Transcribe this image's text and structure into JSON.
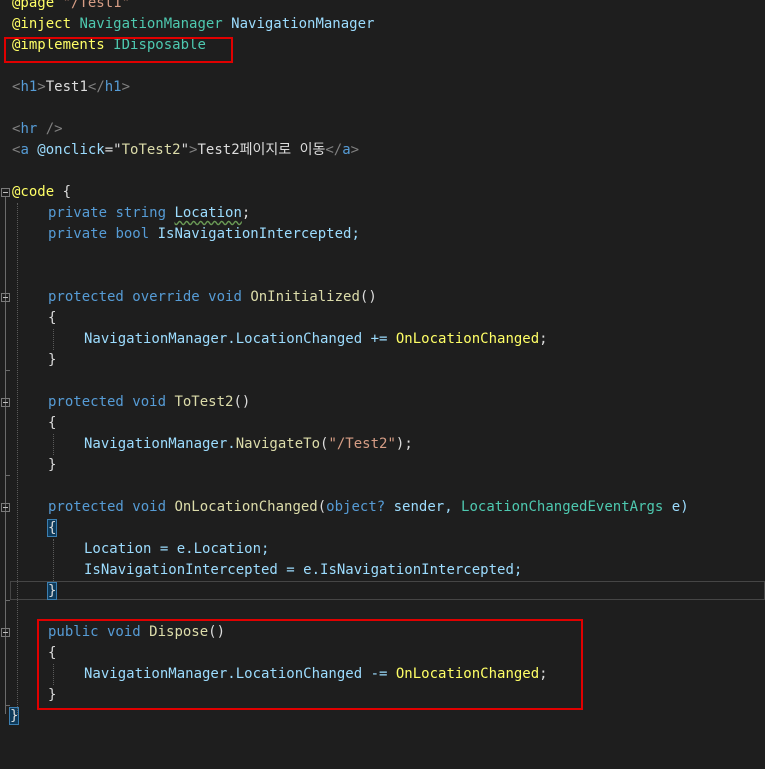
{
  "lines": {
    "l1": {
      "a": "@page ",
      "b": "\"/Test1\""
    },
    "l2": {
      "a": "@inject ",
      "b": "NavigationManager",
      "c": " NavigationManager"
    },
    "l3": {
      "a": "@implements ",
      "b": "IDisposable"
    },
    "l5": {
      "a": "<",
      "b": "h1",
      "c": ">",
      "d": "Test1",
      "e": "</",
      "f": "h1",
      "g": ">"
    },
    "l7": {
      "a": "<",
      "b": "hr",
      "c": " />"
    },
    "l8": {
      "a": "<",
      "b": "a",
      "c": " @onclick",
      "d": "=\"",
      "e": "ToTest2",
      "f": "\"",
      "g": ">",
      "h": "Test2페이지로 이동",
      "i": "</",
      "j": "a",
      "k": ">"
    },
    "l10": {
      "a": "@code",
      "b": " {"
    },
    "l11": {
      "a": "private",
      "b": " string ",
      "c": "Location",
      "d": ";"
    },
    "l12": {
      "a": "private",
      "b": " bool ",
      "c": "IsNavigationIntercepted;"
    },
    "l15": {
      "a": "protected",
      "b": " override ",
      "c": "void ",
      "d": "OnInitialized",
      "e": "()"
    },
    "l16": {
      "a": "{"
    },
    "l17": {
      "a": "NavigationManager.LocationChanged += ",
      "b": "OnLocationChanged",
      "c": ";"
    },
    "l18": {
      "a": "}"
    },
    "l20": {
      "a": "protected",
      "b": " void ",
      "c": "ToTest2",
      "d": "()"
    },
    "l21": {
      "a": "{"
    },
    "l22": {
      "a": "NavigationManager.",
      "b": "NavigateTo",
      "c": "(",
      "d": "\"/Test2\"",
      "e": ");"
    },
    "l23": {
      "a": "}"
    },
    "l25": {
      "a": "protected",
      "b": " void ",
      "c": "OnLocationChanged",
      "d": "(",
      "e": "object?",
      "f": " sender, ",
      "g": "LocationChangedEventArgs",
      "h": " e)"
    },
    "l26": {
      "a": "{"
    },
    "l27": {
      "a": "Location = ",
      "b": "e",
      "c": ".Location;"
    },
    "l28": {
      "a": "IsNavigationIntercepted = ",
      "b": "e",
      "c": ".IsNavigationIntercepted;"
    },
    "l29": {
      "a": "}"
    },
    "l31": {
      "a": "public",
      "b": " void ",
      "c": "Dispose",
      "d": "()"
    },
    "l32": {
      "a": "{"
    },
    "l33": {
      "a": "NavigationManager.LocationChanged -= ",
      "b": "OnLocationChanged",
      "c": ";"
    },
    "l34": {
      "a": "}"
    },
    "l35": {
      "a": "}"
    }
  },
  "colors": {
    "background": "#1e1e1e",
    "keyword": "#569cd6",
    "razor_directive": "#ffff66",
    "type": "#4ec9b0",
    "method": "#dcdcaa",
    "string": "#d69d85",
    "highlight_box": "#e00000"
  }
}
